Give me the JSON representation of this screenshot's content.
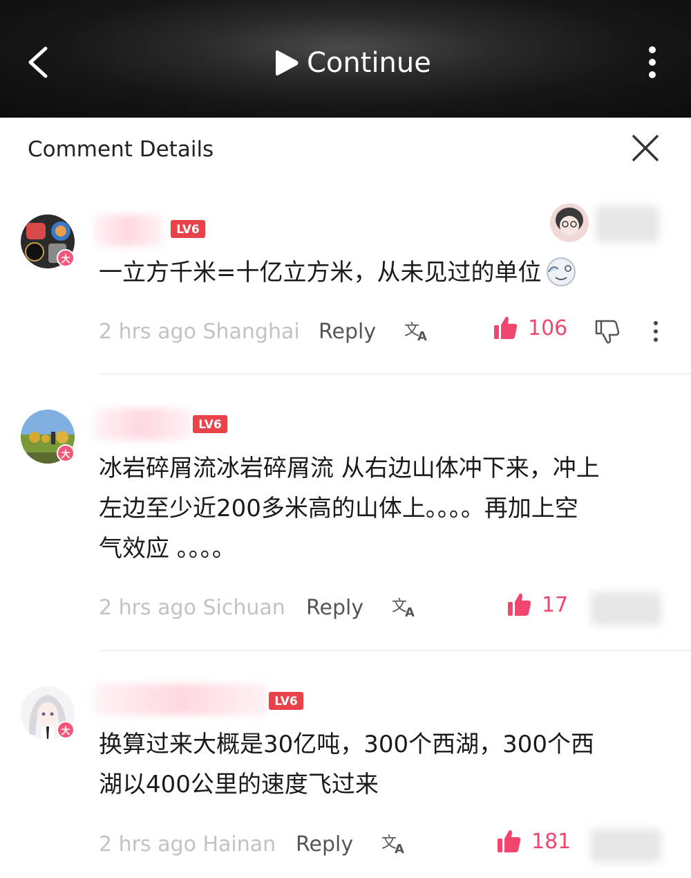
{
  "topbar": {
    "continue_label": "Continue"
  },
  "sheet": {
    "title": "Comment Details"
  },
  "comments": [
    {
      "level": "LV6",
      "content": "一立方千米=十亿立方米，从未见过的单位",
      "meta": "2 hrs ago Shanghai",
      "reply_label": "Reply",
      "likes": "106"
    },
    {
      "level": "LV6",
      "content_lines": [
        "冰岩碎屑流冰岩碎屑流 从右边山体冲下来，冲上",
        "左边至少近200多米高的山体上。。。。再加上空",
        "气效应 。。。。"
      ],
      "meta": "2 hrs ago Sichuan",
      "reply_label": "Reply",
      "likes": "17"
    },
    {
      "level": "LV6",
      "content_lines": [
        "换算过来大概是30亿吨，300个西湖，300个西",
        "湖以400公里的速度飞过来"
      ],
      "meta": "2 hrs ago Hainan",
      "reply_label": "Reply",
      "likes": "181"
    }
  ],
  "badges": {
    "vip_char": "大"
  },
  "colors": {
    "accent_pink": "#f0466e",
    "level_red": "#e8424a",
    "topbar_bg": "#161616"
  }
}
